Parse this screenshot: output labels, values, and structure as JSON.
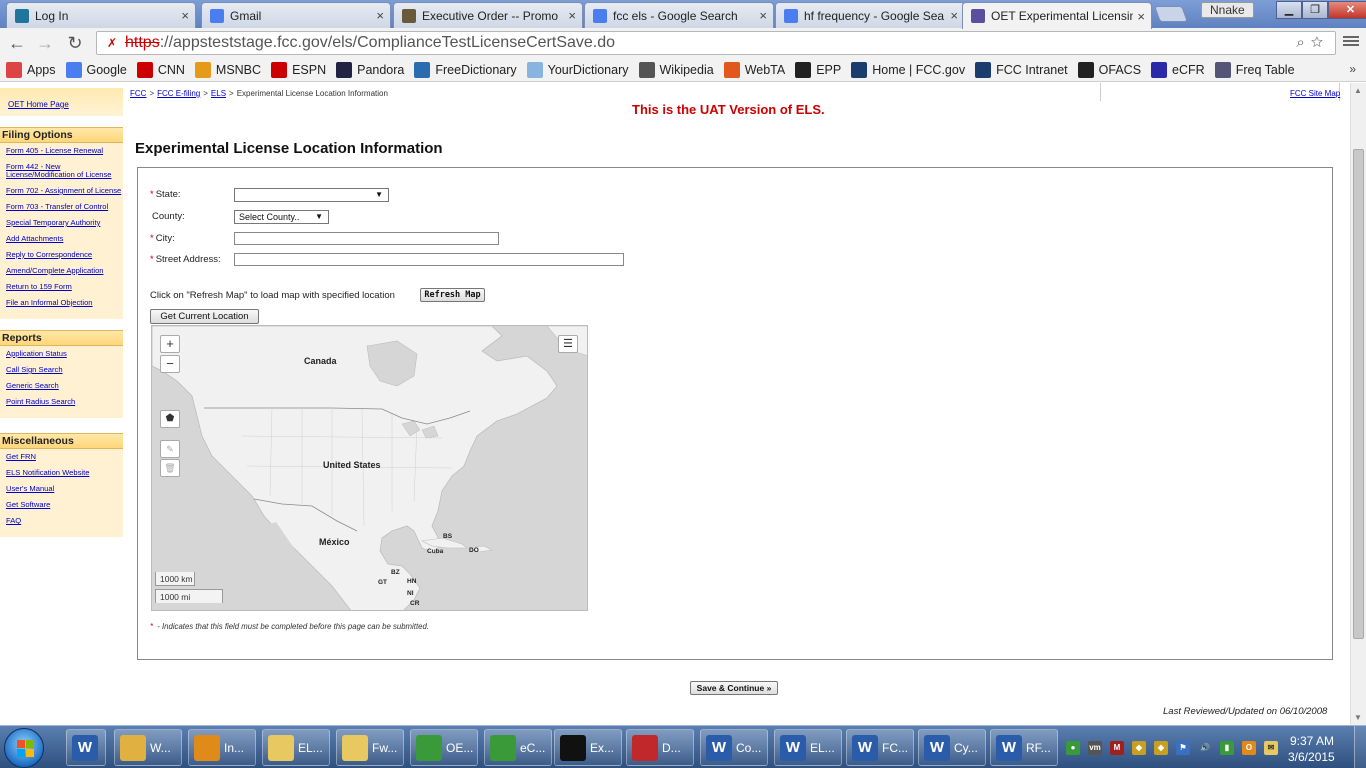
{
  "browser": {
    "tabs": [
      {
        "title": "Log In",
        "icon": "wordpress-icon",
        "color": "#21759b"
      },
      {
        "title": "Gmail",
        "icon": "google-icon",
        "color": "#4a7df0"
      },
      {
        "title": "Executive Order -- Promo",
        "icon": "whitehouse-icon",
        "color": "#6a5a3a"
      },
      {
        "title": "fcc els - Google Search",
        "icon": "google-icon",
        "color": "#4a7df0"
      },
      {
        "title": "hf frequency - Google Sea",
        "icon": "google-icon",
        "color": "#4a7df0"
      },
      {
        "title": "OET Experimental Licensin",
        "icon": "fcc-icon",
        "color": "#5b4fa0"
      }
    ],
    "user": "Nnake",
    "url_scheme": "https",
    "url_rest": "://appsteststage.fcc.gov/els/ComplianceTestLicenseCertSave.do",
    "bookmarks": [
      {
        "label": "Apps",
        "icon": "apps-grid-icon",
        "color": "#d44"
      },
      {
        "label": "Google",
        "icon": "google-icon",
        "color": "#4a7df0"
      },
      {
        "label": "CNN",
        "icon": "cnn-icon",
        "color": "#c00"
      },
      {
        "label": "MSNBC",
        "icon": "msnbc-icon",
        "color": "#e69a1a"
      },
      {
        "label": "ESPN",
        "icon": "espn-icon",
        "color": "#c00"
      },
      {
        "label": "Pandora",
        "icon": "pandora-icon",
        "color": "#224"
      },
      {
        "label": "FreeDictionary",
        "icon": "freedictionary-icon",
        "color": "#2b6cb0"
      },
      {
        "label": "YourDictionary",
        "icon": "yourdictionary-icon",
        "color": "#8ab4e0"
      },
      {
        "label": "Wikipedia",
        "icon": "wikipedia-icon",
        "color": "#555"
      },
      {
        "label": "WebTA",
        "icon": "webta-icon",
        "color": "#e2571e"
      },
      {
        "label": "EPP",
        "icon": "epp-icon",
        "color": "#222"
      },
      {
        "label": "Home | FCC.gov",
        "icon": "fcc-icon",
        "color": "#1a3d6e"
      },
      {
        "label": "FCC Intranet",
        "icon": "fcc-icon",
        "color": "#1a3d6e"
      },
      {
        "label": "OFACS",
        "icon": "ofacs-icon",
        "color": "#222"
      },
      {
        "label": "eCFR",
        "icon": "gpo-icon",
        "color": "#2a2aa8"
      },
      {
        "label": "Freq Table",
        "icon": "freqtable-icon",
        "color": "#557"
      }
    ]
  },
  "sidebar": {
    "home_link": "OET Home Page",
    "sections": [
      {
        "title": "Filing Options",
        "links": [
          "Form 405 - License Renewal",
          "Form 442 - New License/Modification of License",
          "Form 702 - Assignment of License",
          "Form 703 - Transfer of Control",
          "Special Temporary Authority",
          "Add Attachments",
          "Reply to Correspondence",
          "Amend/Complete Application",
          "Return to 159 Form",
          "File an Informal Objection"
        ]
      },
      {
        "title": "Reports",
        "links": [
          "Application Status",
          "Call Sign Search",
          "Generic Search",
          "Point Radius Search"
        ]
      },
      {
        "title": "Miscellaneous",
        "links": [
          "Get FRN",
          "ELS Notification Website",
          "User's Manual",
          "Get Software",
          "FAQ"
        ]
      }
    ]
  },
  "breadcrumb": {
    "items": [
      "FCC",
      "FCC E-filing",
      "ELS"
    ],
    "separator": ">",
    "current": "Experimental License Location Information"
  },
  "site_map": "FCC Site Map",
  "banner": "This is the UAT Version of ELS.",
  "page_title": "Experimental License Location Information",
  "form": {
    "required_mark": "*",
    "state_label": "State:",
    "state_value": "",
    "county_label": "County:",
    "county_value": "Select County..",
    "city_label": "City:",
    "city_value": "",
    "street_label": "Street Address:",
    "street_value": "",
    "refresh_hint": "Click on \"Refresh Map\" to load map with specified location",
    "refresh_button": "Refresh Map",
    "location_button": "Get Current Location",
    "required_note": " - Indicates that this field must be completed before this page can be submitted.",
    "save_button": "Save & Continue »"
  },
  "map": {
    "zoom_in": "+",
    "zoom_out": "−",
    "labels": {
      "canada": "Canada",
      "united_states": "United States",
      "mexico": "México",
      "bs": "BS",
      "cuba": "Cuba",
      "do": "DO",
      "bz": "BZ",
      "gt": "GT",
      "hn": "HN",
      "ni": "NI",
      "cr": "CR"
    },
    "scale_km": "1000 km",
    "scale_mi": "1000 mi",
    "land_color": "#f1f1f1",
    "water_color": "#d6d6d6"
  },
  "footer": {
    "reviewed": "Last Reviewed/Updated on 06/10/2008"
  },
  "taskbar": {
    "items": [
      {
        "label": "",
        "icon": "word-icon",
        "color": "#2a5caa"
      },
      {
        "label": "W...",
        "icon": "folder-icon",
        "color": "#e0b040"
      },
      {
        "label": "In...",
        "icon": "outlook-icon",
        "color": "#e08a1a"
      },
      {
        "label": "EL...",
        "icon": "mail-icon",
        "color": "#e8c860"
      },
      {
        "label": "Fw...",
        "icon": "mail-icon",
        "color": "#e8c860"
      },
      {
        "label": "OE...",
        "icon": "chrome-icon",
        "color": "#3a9a3a"
      },
      {
        "label": "eC...",
        "icon": "chrome-icon",
        "color": "#3a9a3a"
      },
      {
        "label": "Ex...",
        "icon": "prism-icon",
        "color": "#111"
      },
      {
        "label": "D...",
        "icon": "pdf-icon",
        "color": "#c0282b"
      },
      {
        "label": "Co...",
        "icon": "word-icon",
        "color": "#2a5caa"
      },
      {
        "label": "EL...",
        "icon": "word-icon",
        "color": "#2a5caa"
      },
      {
        "label": "FC...",
        "icon": "word-icon",
        "color": "#2a5caa"
      },
      {
        "label": "Cy...",
        "icon": "word-icon",
        "color": "#2a5caa"
      },
      {
        "label": "RF...",
        "icon": "word-icon",
        "color": "#2a5caa"
      }
    ],
    "clock_time": "9:37 AM",
    "clock_date": "3/6/2015"
  }
}
